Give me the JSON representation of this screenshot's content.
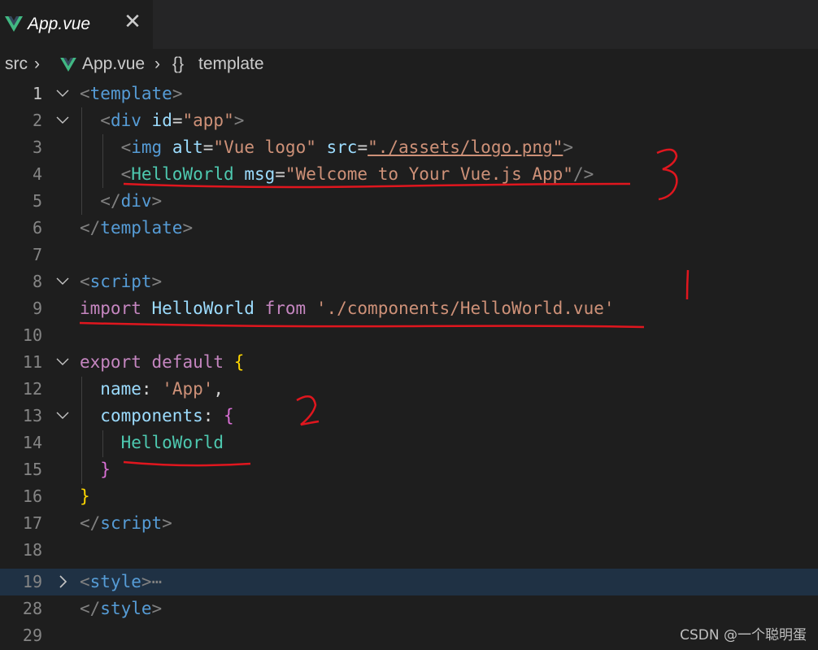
{
  "tab": {
    "title": "App.vue",
    "close_label": "✕",
    "icon": "vue-icon"
  },
  "breadcrumb": {
    "root": "src",
    "file": "App.vue",
    "symbol_icon": "{}",
    "symbol": "template"
  },
  "lines": [
    {
      "n": "1",
      "fold": "open"
    },
    {
      "n": "2",
      "fold": "open"
    },
    {
      "n": "3",
      "fold": ""
    },
    {
      "n": "4",
      "fold": ""
    },
    {
      "n": "5",
      "fold": ""
    },
    {
      "n": "6",
      "fold": ""
    },
    {
      "n": "7",
      "fold": ""
    },
    {
      "n": "8",
      "fold": "open"
    },
    {
      "n": "9",
      "fold": ""
    },
    {
      "n": "10",
      "fold": ""
    },
    {
      "n": "11",
      "fold": "open"
    },
    {
      "n": "12",
      "fold": ""
    },
    {
      "n": "13",
      "fold": "open"
    },
    {
      "n": "14",
      "fold": ""
    },
    {
      "n": "15",
      "fold": ""
    },
    {
      "n": "16",
      "fold": ""
    },
    {
      "n": "17",
      "fold": ""
    },
    {
      "n": "18",
      "fold": ""
    },
    {
      "n": "19",
      "fold": "closed"
    },
    {
      "n": "28",
      "fold": ""
    },
    {
      "n": "29",
      "fold": ""
    }
  ],
  "code": {
    "l1": {
      "lt": "<",
      "tag": "template",
      "gt": ">"
    },
    "l2": {
      "lt": "<",
      "tag": "div",
      "attr": "id",
      "eq": "=",
      "val": "\"app\"",
      "gt": ">"
    },
    "l3": {
      "lt": "<",
      "tag": "img",
      "a1": "alt",
      "eq1": "=",
      "v1": "\"Vue logo\"",
      "a2": "src",
      "eq2": "=",
      "v2": "\"./assets/logo.png\"",
      "gt": ">"
    },
    "l4": {
      "lt": "<",
      "comp": "HelloWorld",
      "attr": "msg",
      "eq": "=",
      "val": "\"Welcome to Your Vue.js App\"",
      "end": "/>"
    },
    "l5": {
      "lt": "</",
      "tag": "div",
      "gt": ">"
    },
    "l6": {
      "lt": "</",
      "tag": "template",
      "gt": ">"
    },
    "l8": {
      "lt": "<",
      "tag": "script",
      "gt": ">"
    },
    "l9": {
      "import": "import",
      "name": "HelloWorld",
      "from": "from",
      "path": "'./components/HelloWorld.vue'"
    },
    "l11": {
      "export": "export",
      "default": "default",
      "brace": "{"
    },
    "l12": {
      "key": "name",
      "colon": ":",
      "val": "'App'",
      "comma": ","
    },
    "l13": {
      "key": "components",
      "colon": ":",
      "brace": "{"
    },
    "l14": {
      "comp": "HelloWorld"
    },
    "l15": {
      "brace": "}"
    },
    "l16": {
      "brace": "}"
    },
    "l17": {
      "lt": "</",
      "tag": "script",
      "gt": ">"
    },
    "l19": {
      "lt": "<",
      "tag": "style",
      "gt": ">",
      "ellipsis": "⋯"
    },
    "l28": {
      "lt": "</",
      "tag": "style",
      "gt": ">"
    }
  },
  "annotations": {
    "mark1": "1",
    "mark2": "2",
    "mark3": "3"
  },
  "watermark": "CSDN @一个聪明蛋",
  "colors": {
    "annotation": "#e0161e",
    "vue_green": "#41b883",
    "vue_dark": "#35495e"
  }
}
